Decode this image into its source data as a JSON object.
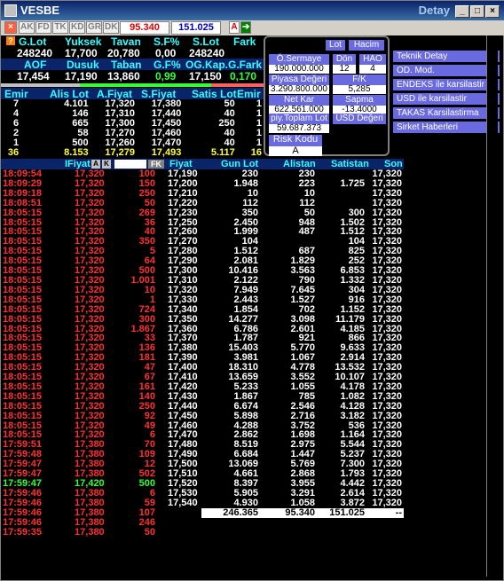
{
  "window": {
    "title": "VESBE",
    "right_title": "Detay"
  },
  "toolbar": {
    "buttons": [
      "AK",
      "FD",
      "TK",
      "KD",
      "GR",
      "DK"
    ],
    "value1": "95.340",
    "value2": "151.025",
    "a_label": "A",
    "arrow_label": "➔"
  },
  "summary": {
    "row1_headers": [
      "G.Lot",
      "Yuksek",
      "Tavan",
      "S.F%",
      "S.Lot",
      "Fark"
    ],
    "row1_values": [
      "248240",
      "17,700",
      "20,780",
      "0,00",
      "248240",
      ""
    ],
    "row2_headers": [
      "AOF",
      "Dusuk",
      "Taban",
      "G.F%",
      "OG.Kap.",
      "G.Fark"
    ],
    "row2_values": [
      "17,454",
      "17,190",
      "13,860",
      "0,99",
      "17,150",
      "0,170"
    ]
  },
  "depth": {
    "headers": [
      "Emir",
      "Alis Lot",
      "A.Fiyat",
      "S.Fiyat",
      "Satis Lot",
      "Emir"
    ],
    "rows": [
      [
        "7",
        "4.101",
        "17,320",
        "17,380",
        "50",
        "1"
      ],
      [
        "4",
        "146",
        "17,310",
        "17,440",
        "40",
        "1"
      ],
      [
        "6",
        "665",
        "17,300",
        "17,450",
        "250",
        "1"
      ],
      [
        "2",
        "58",
        "17,270",
        "17,460",
        "40",
        "1"
      ],
      [
        "1",
        "500",
        "17,260",
        "17,470",
        "40",
        "1"
      ]
    ],
    "totals": [
      "36",
      "8.153",
      "17,279",
      "17,493",
      "5.117",
      "16"
    ]
  },
  "panel": {
    "lot_label": "Lot",
    "hacim_label": "Hacim",
    "sermaye_label": "Ö.Sermaye",
    "sermaye_value": "190.000.000",
    "don_label": "Dön",
    "don_value": "12",
    "hao_label": "HAO",
    "hao_value": "4",
    "piyasa_label": "Piyasa Değeri",
    "piyasa_value": "3.290.800.000",
    "fk_label": "F/K",
    "fk_value": "5,285",
    "netkar_label": "Net Kar",
    "netkar_value": "622.561.000",
    "sapma_label": "Sapma",
    "sapma_value": "-13.4000",
    "piy_label": "piy.Toplam Lot",
    "piy_value": "59.687.373",
    "usd_label": "USD Değeri",
    "risk_label": "Risk Kodu",
    "risk_value": "A"
  },
  "links": [
    "Teknik Detay",
    "OD. Mod.",
    "ENDEKS ile karsilastir",
    "USD ile karsilastir",
    "TAKAS Karsilastirma",
    "Sirket Haberleri"
  ],
  "trades": {
    "headers": {
      "time": "",
      "price": "IFiyat",
      "lot": "",
      "a": "A",
      "k": "K",
      "fk": "FK"
    },
    "rows": [
      [
        "18:09:54",
        "17,320",
        "100",
        "r"
      ],
      [
        "18:09:29",
        "17,320",
        "150",
        "r"
      ],
      [
        "18:09:18",
        "17,320",
        "250",
        "r"
      ],
      [
        "18:08:51",
        "17,320",
        "50",
        "r"
      ],
      [
        "18:05:15",
        "17,320",
        "269",
        "r"
      ],
      [
        "18:05:15",
        "17,320",
        "36",
        "r"
      ],
      [
        "18:05:15",
        "17,320",
        "40",
        "r"
      ],
      [
        "18:05:15",
        "17,320",
        "350",
        "r"
      ],
      [
        "18:05:15",
        "17,320",
        "5",
        "r"
      ],
      [
        "18:05:15",
        "17,320",
        "64",
        "r"
      ],
      [
        "18:05:15",
        "17,320",
        "500",
        "r"
      ],
      [
        "18:05:15",
        "17,320",
        "1.001",
        "r"
      ],
      [
        "18:05:15",
        "17,320",
        "10",
        "r"
      ],
      [
        "18:05:15",
        "17,320",
        "1",
        "r"
      ],
      [
        "18:05:15",
        "17,320",
        "724",
        "r"
      ],
      [
        "18:05:15",
        "17,320",
        "300",
        "r"
      ],
      [
        "18:05:15",
        "17,320",
        "1.867",
        "r"
      ],
      [
        "18:05:15",
        "17,320",
        "33",
        "r"
      ],
      [
        "18:05:15",
        "17,320",
        "136",
        "r"
      ],
      [
        "18:05:15",
        "17,320",
        "181",
        "r"
      ],
      [
        "18:05:15",
        "17,320",
        "47",
        "r"
      ],
      [
        "18:05:15",
        "17,320",
        "67",
        "r"
      ],
      [
        "18:05:15",
        "17,320",
        "161",
        "r"
      ],
      [
        "18:05:15",
        "17,320",
        "140",
        "r"
      ],
      [
        "18:05:15",
        "17,320",
        "250",
        "r"
      ],
      [
        "18:05:15",
        "17,320",
        "92",
        "r"
      ],
      [
        "18:05:15",
        "17,320",
        "49",
        "r"
      ],
      [
        "18:05:15",
        "17,320",
        "6",
        "r"
      ],
      [
        "17:59:51",
        "17,380",
        "70",
        "r"
      ],
      [
        "17:59:48",
        "17,380",
        "109",
        "r"
      ],
      [
        "17:59:47",
        "17,380",
        "12",
        "r"
      ],
      [
        "17:59:47",
        "17,380",
        "502",
        "r"
      ],
      [
        "17:59:47",
        "17,420",
        "500",
        "g"
      ],
      [
        "17:59:46",
        "17,380",
        "6",
        "r"
      ],
      [
        "17:59:46",
        "17,380",
        "59",
        "r"
      ],
      [
        "17:59:46",
        "17,380",
        "107",
        "r"
      ],
      [
        "17:59:46",
        "17,380",
        "246",
        "r"
      ],
      [
        "17:59:35",
        "17,380",
        "50",
        "r"
      ]
    ]
  },
  "distribution": {
    "headers": [
      "Fiyat",
      "Gun Lot",
      "Alistan",
      "Satistan",
      "Son"
    ],
    "rows": [
      [
        "17,190",
        "230",
        "230",
        "",
        "17,320"
      ],
      [
        "17,200",
        "1.948",
        "223",
        "1.725",
        "17,320"
      ],
      [
        "17,210",
        "10",
        "10",
        "",
        "17,320"
      ],
      [
        "17,220",
        "112",
        "112",
        "",
        "17,320"
      ],
      [
        "17,230",
        "350",
        "50",
        "300",
        "17,320"
      ],
      [
        "17,250",
        "2.450",
        "948",
        "1.502",
        "17,320"
      ],
      [
        "17,260",
        "1.999",
        "487",
        "1.512",
        "17,320"
      ],
      [
        "17,270",
        "104",
        "",
        "104",
        "17,320"
      ],
      [
        "17,280",
        "1.512",
        "687",
        "825",
        "17,320"
      ],
      [
        "17,290",
        "2.081",
        "1.829",
        "252",
        "17,320"
      ],
      [
        "17,300",
        "10.416",
        "3.563",
        "6.853",
        "17,320"
      ],
      [
        "17,310",
        "2.122",
        "790",
        "1.332",
        "17,320"
      ],
      [
        "17,320",
        "7.949",
        "7.645",
        "304",
        "17,320"
      ],
      [
        "17,330",
        "2.443",
        "1.527",
        "916",
        "17,320"
      ],
      [
        "17,340",
        "1.854",
        "702",
        "1.152",
        "17,320"
      ],
      [
        "17,350",
        "14.277",
        "3.098",
        "11.179",
        "17,320"
      ],
      [
        "17,360",
        "6.786",
        "2.601",
        "4.185",
        "17,320"
      ],
      [
        "17,370",
        "1.787",
        "921",
        "866",
        "17,320"
      ],
      [
        "17,380",
        "15.403",
        "5.770",
        "9.633",
        "17,320"
      ],
      [
        "17,390",
        "3.981",
        "1.067",
        "2.914",
        "17,320"
      ],
      [
        "17,400",
        "18.310",
        "4.778",
        "13.532",
        "17,320"
      ],
      [
        "17,410",
        "13.659",
        "3.552",
        "10.107",
        "17,320"
      ],
      [
        "17,420",
        "5.233",
        "1.055",
        "4.178",
        "17,320"
      ],
      [
        "17,430",
        "1.867",
        "785",
        "1.082",
        "17,320"
      ],
      [
        "17,440",
        "6.674",
        "2.546",
        "4.128",
        "17,320"
      ],
      [
        "17,450",
        "5.898",
        "2.716",
        "3.182",
        "17,320"
      ],
      [
        "17,460",
        "4.288",
        "3.752",
        "536",
        "17,320"
      ],
      [
        "17,470",
        "2.862",
        "1.698",
        "1.164",
        "17,320"
      ],
      [
        "17,480",
        "8.519",
        "2.975",
        "5.544",
        "17,320"
      ],
      [
        "17,490",
        "6.684",
        "1.447",
        "5.237",
        "17,320"
      ],
      [
        "17,500",
        "13.069",
        "5.769",
        "7.300",
        "17,320"
      ],
      [
        "17,510",
        "4.661",
        "2.868",
        "1.793",
        "17,320"
      ],
      [
        "17,520",
        "8.397",
        "3.955",
        "4.442",
        "17,320"
      ],
      [
        "17,530",
        "5.905",
        "3.291",
        "2.614",
        "17,320"
      ],
      [
        "17,540",
        "4.930",
        "1.058",
        "3.872",
        "17,320"
      ]
    ],
    "totals": [
      "",
      "246.365",
      "95.340",
      "151.025",
      "--"
    ]
  },
  "colors": {
    "red": "#ff3030",
    "green": "#33ff33",
    "yellow": "#ffff33",
    "cyan": "#33ffff",
    "header_blue": "#0a246a"
  }
}
